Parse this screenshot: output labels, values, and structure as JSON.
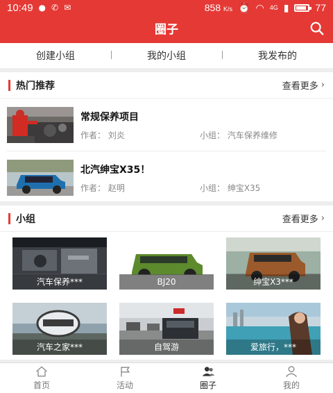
{
  "status_bar": {
    "time": "10:49",
    "speed": "858",
    "speed_unit": "K/s",
    "network": "4G",
    "battery": "77"
  },
  "header": {
    "title": "圈子"
  },
  "tabs": [
    {
      "label": "创建小组"
    },
    {
      "label": "我的小组"
    },
    {
      "label": "我发布的"
    }
  ],
  "hot": {
    "title": "热门推荐",
    "more": "查看更多",
    "posts": [
      {
        "title": "常规保养项目",
        "author": "作者：  刘炎",
        "group": "小组：  汽车保养维修"
      },
      {
        "title": "北汽绅宝X35！",
        "author": "作者：  赵明",
        "group": "小组：  绅宝X35"
      }
    ]
  },
  "groups": {
    "title": "小组",
    "more": "查看更多",
    "items": [
      {
        "label": "汽车保养***"
      },
      {
        "label": "BJ20"
      },
      {
        "label": "绅宝X3***"
      },
      {
        "label": "汽车之家***"
      },
      {
        "label": "自驾游"
      },
      {
        "label": "爱旅行，***"
      }
    ]
  },
  "bottom_nav": [
    {
      "label": "首页",
      "icon": "home-icon"
    },
    {
      "label": "活动",
      "icon": "flag-icon"
    },
    {
      "label": "圈子",
      "icon": "group-icon",
      "active": true
    },
    {
      "label": "我的",
      "icon": "person-icon"
    }
  ],
  "colors": {
    "brand_red": "#e53935"
  }
}
